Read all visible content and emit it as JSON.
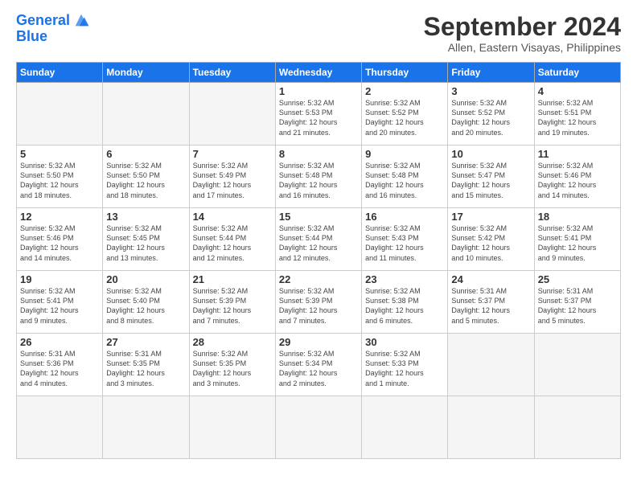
{
  "logo": {
    "line1": "General",
    "line2": "Blue"
  },
  "title": "September 2024",
  "location": "Allen, Eastern Visayas, Philippines",
  "weekdays": [
    "Sunday",
    "Monday",
    "Tuesday",
    "Wednesday",
    "Thursday",
    "Friday",
    "Saturday"
  ],
  "days": [
    {
      "num": "",
      "info": ""
    },
    {
      "num": "",
      "info": ""
    },
    {
      "num": "",
      "info": ""
    },
    {
      "num": "1",
      "info": "Sunrise: 5:32 AM\nSunset: 5:53 PM\nDaylight: 12 hours\nand 21 minutes."
    },
    {
      "num": "2",
      "info": "Sunrise: 5:32 AM\nSunset: 5:52 PM\nDaylight: 12 hours\nand 20 minutes."
    },
    {
      "num": "3",
      "info": "Sunrise: 5:32 AM\nSunset: 5:52 PM\nDaylight: 12 hours\nand 20 minutes."
    },
    {
      "num": "4",
      "info": "Sunrise: 5:32 AM\nSunset: 5:51 PM\nDaylight: 12 hours\nand 19 minutes."
    },
    {
      "num": "5",
      "info": "Sunrise: 5:32 AM\nSunset: 5:50 PM\nDaylight: 12 hours\nand 18 minutes."
    },
    {
      "num": "6",
      "info": "Sunrise: 5:32 AM\nSunset: 5:50 PM\nDaylight: 12 hours\nand 18 minutes."
    },
    {
      "num": "7",
      "info": "Sunrise: 5:32 AM\nSunset: 5:49 PM\nDaylight: 12 hours\nand 17 minutes."
    },
    {
      "num": "8",
      "info": "Sunrise: 5:32 AM\nSunset: 5:48 PM\nDaylight: 12 hours\nand 16 minutes."
    },
    {
      "num": "9",
      "info": "Sunrise: 5:32 AM\nSunset: 5:48 PM\nDaylight: 12 hours\nand 16 minutes."
    },
    {
      "num": "10",
      "info": "Sunrise: 5:32 AM\nSunset: 5:47 PM\nDaylight: 12 hours\nand 15 minutes."
    },
    {
      "num": "11",
      "info": "Sunrise: 5:32 AM\nSunset: 5:46 PM\nDaylight: 12 hours\nand 14 minutes."
    },
    {
      "num": "12",
      "info": "Sunrise: 5:32 AM\nSunset: 5:46 PM\nDaylight: 12 hours\nand 14 minutes."
    },
    {
      "num": "13",
      "info": "Sunrise: 5:32 AM\nSunset: 5:45 PM\nDaylight: 12 hours\nand 13 minutes."
    },
    {
      "num": "14",
      "info": "Sunrise: 5:32 AM\nSunset: 5:44 PM\nDaylight: 12 hours\nand 12 minutes."
    },
    {
      "num": "15",
      "info": "Sunrise: 5:32 AM\nSunset: 5:44 PM\nDaylight: 12 hours\nand 12 minutes."
    },
    {
      "num": "16",
      "info": "Sunrise: 5:32 AM\nSunset: 5:43 PM\nDaylight: 12 hours\nand 11 minutes."
    },
    {
      "num": "17",
      "info": "Sunrise: 5:32 AM\nSunset: 5:42 PM\nDaylight: 12 hours\nand 10 minutes."
    },
    {
      "num": "18",
      "info": "Sunrise: 5:32 AM\nSunset: 5:41 PM\nDaylight: 12 hours\nand 9 minutes."
    },
    {
      "num": "19",
      "info": "Sunrise: 5:32 AM\nSunset: 5:41 PM\nDaylight: 12 hours\nand 9 minutes."
    },
    {
      "num": "20",
      "info": "Sunrise: 5:32 AM\nSunset: 5:40 PM\nDaylight: 12 hours\nand 8 minutes."
    },
    {
      "num": "21",
      "info": "Sunrise: 5:32 AM\nSunset: 5:39 PM\nDaylight: 12 hours\nand 7 minutes."
    },
    {
      "num": "22",
      "info": "Sunrise: 5:32 AM\nSunset: 5:39 PM\nDaylight: 12 hours\nand 7 minutes."
    },
    {
      "num": "23",
      "info": "Sunrise: 5:32 AM\nSunset: 5:38 PM\nDaylight: 12 hours\nand 6 minutes."
    },
    {
      "num": "24",
      "info": "Sunrise: 5:31 AM\nSunset: 5:37 PM\nDaylight: 12 hours\nand 5 minutes."
    },
    {
      "num": "25",
      "info": "Sunrise: 5:31 AM\nSunset: 5:37 PM\nDaylight: 12 hours\nand 5 minutes."
    },
    {
      "num": "26",
      "info": "Sunrise: 5:31 AM\nSunset: 5:36 PM\nDaylight: 12 hours\nand 4 minutes."
    },
    {
      "num": "27",
      "info": "Sunrise: 5:31 AM\nSunset: 5:35 PM\nDaylight: 12 hours\nand 3 minutes."
    },
    {
      "num": "28",
      "info": "Sunrise: 5:32 AM\nSunset: 5:35 PM\nDaylight: 12 hours\nand 3 minutes."
    },
    {
      "num": "29",
      "info": "Sunrise: 5:32 AM\nSunset: 5:34 PM\nDaylight: 12 hours\nand 2 minutes."
    },
    {
      "num": "30",
      "info": "Sunrise: 5:32 AM\nSunset: 5:33 PM\nDaylight: 12 hours\nand 1 minute."
    },
    {
      "num": "",
      "info": ""
    },
    {
      "num": "",
      "info": ""
    },
    {
      "num": "",
      "info": ""
    },
    {
      "num": "",
      "info": ""
    },
    {
      "num": "",
      "info": ""
    }
  ]
}
